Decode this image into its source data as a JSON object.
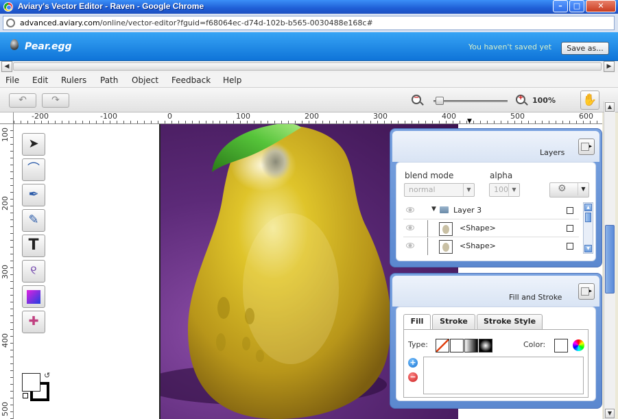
{
  "window": {
    "title": "Aviary's Vector Editor - Raven - Google Chrome",
    "minimize": "–",
    "maximize": "□",
    "close": "✕"
  },
  "browser": {
    "url_domain": "advanced.aviary.com",
    "url_path": "/online/vector-editor?fguid=f68064ec-d74d-102b-b565-0030488e168c#"
  },
  "app": {
    "file_name": "Pear.egg",
    "save_status": "You haven't saved yet",
    "save_as_label": "Save as..."
  },
  "menu": [
    "File",
    "Edit",
    "Rulers",
    "Path",
    "Object",
    "Feedback",
    "Help"
  ],
  "toolbar": {
    "undo_icon": "↶",
    "redo_icon": "↷",
    "zoom_percent": "100%",
    "zoom_level": 1.0,
    "hand_icon": "✋"
  },
  "rulers": {
    "horizontal": [
      "-200",
      "-100",
      "0",
      "100",
      "200",
      "300",
      "400",
      "500",
      "600"
    ],
    "vertical": [
      "100",
      "200",
      "300",
      "400",
      "500"
    ]
  },
  "tools": [
    {
      "name": "selection-tool",
      "icon": "➤"
    },
    {
      "name": "node-tool",
      "icon": "⌒"
    },
    {
      "name": "pen-tool",
      "icon": "✒"
    },
    {
      "name": "pencil-tool",
      "icon": "✎"
    },
    {
      "name": "text-tool",
      "icon": "T"
    },
    {
      "name": "spiral-tool",
      "icon": "୧"
    },
    {
      "name": "gradient-tool",
      "icon": ""
    },
    {
      "name": "transform-tool",
      "icon": "✚"
    }
  ],
  "layers_panel": {
    "title": "Layers",
    "blend_mode_label": "blend mode",
    "blend_mode_value": "normal",
    "alpha_label": "alpha",
    "alpha_value": "100",
    "rows": [
      {
        "name": "Layer 3",
        "kind": "folder"
      },
      {
        "name": "<Shape>",
        "kind": "shape"
      },
      {
        "name": "<Shape>",
        "kind": "shape"
      }
    ]
  },
  "fill_stroke_panel": {
    "title": "Fill and Stroke",
    "tabs": [
      "Fill",
      "Stroke",
      "Stroke Style"
    ],
    "active_tab": "Fill",
    "type_label": "Type:",
    "color_label": "Color:"
  },
  "colors": {
    "header_blue": "#1a86e6",
    "artboard_purple": "#4a1c62",
    "pear_yellow": "#d2b81c",
    "leaf_green": "#3da82a"
  }
}
